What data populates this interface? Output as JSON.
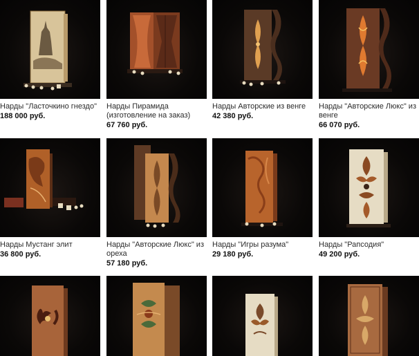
{
  "products": [
    {
      "title": "Нарды \"Ласточкино гнездо\"",
      "price": "188 000 руб."
    },
    {
      "title": "Нарды Пирамида (изготовление на заказ)",
      "price": "67 760 руб."
    },
    {
      "title": "Нарды Авторские из венге",
      "price": "42 380 руб."
    },
    {
      "title": "Нарды \"Авторские Люкс\" из венге",
      "price": "66 070 руб."
    },
    {
      "title": "Нарды Мустанг элит",
      "price": "36 800 руб."
    },
    {
      "title": "Нарды \"Авторские Люкс\" из ореха",
      "price": "57 180 руб."
    },
    {
      "title": "Нарды \"Игры разума\"",
      "price": "29 180 руб."
    },
    {
      "title": "Нарды \"Рапсодия\"",
      "price": "49 200 руб."
    }
  ],
  "colors": {
    "photo_background": "#0a0807",
    "title_text": "#2b2b2b",
    "price_text": "#111111"
  }
}
